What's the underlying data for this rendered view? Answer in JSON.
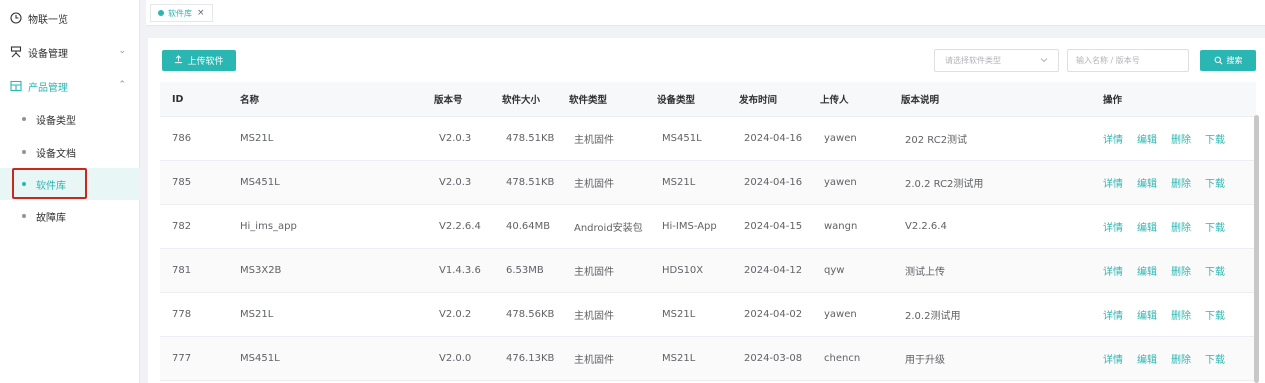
{
  "sidebar": {
    "items": [
      {
        "label": "物联一览",
        "icon": "clock-icon"
      },
      {
        "label": "设备管理",
        "icon": "device-icon",
        "chevron": "⌄"
      },
      {
        "label": "产品管理",
        "icon": "product-icon",
        "chevron": "⌃"
      }
    ],
    "sub_items": [
      {
        "label": "设备类型"
      },
      {
        "label": "设备文档"
      },
      {
        "label": "软件库"
      },
      {
        "label": "故障库"
      }
    ]
  },
  "tab": {
    "label": "软件库",
    "close": "×"
  },
  "toolbar": {
    "upload_label": "上传软件",
    "type_select_placeholder": "请选择软件类型",
    "search_placeholder": "输入名称 / 版本号",
    "search_label": "搜索"
  },
  "table": {
    "headers": [
      "ID",
      "名称",
      "版本号",
      "软件大小",
      "软件类型",
      "设备类型",
      "发布时间",
      "上传人",
      "版本说明",
      "操作"
    ],
    "actions": [
      "详情",
      "编辑",
      "删除",
      "下载"
    ],
    "rows": [
      {
        "id": "786",
        "name": "MS21L",
        "version": "V2.0.3",
        "size": "478.51KB",
        "type": "主机固件",
        "device": "MS451L",
        "date": "2024-04-16",
        "uploader": "yawen",
        "notes": "202 RC2测试"
      },
      {
        "id": "785",
        "name": "MS451L",
        "version": "V2.0.3",
        "size": "478.51KB",
        "type": "主机固件",
        "device": "MS21L",
        "date": "2024-04-16",
        "uploader": "yawen",
        "notes": "2.0.2 RC2测试用"
      },
      {
        "id": "782",
        "name": "Hi_ims_app",
        "version": "V2.2.6.4",
        "size": "40.64MB",
        "type": "Android安装包",
        "device": "Hi-IMS-App",
        "date": "2024-04-15",
        "uploader": "wangn",
        "notes": "V2.2.6.4"
      },
      {
        "id": "781",
        "name": "MS3X2B",
        "version": "V1.4.3.6",
        "size": "6.53MB",
        "type": "主机固件",
        "device": "HDS10X",
        "date": "2024-04-12",
        "uploader": "qyw",
        "notes": "测试上传"
      },
      {
        "id": "778",
        "name": "MS21L",
        "version": "V2.0.2",
        "size": "478.56KB",
        "type": "主机固件",
        "device": "MS21L",
        "date": "2024-04-02",
        "uploader": "yawen",
        "notes": "2.0.2测试用"
      },
      {
        "id": "777",
        "name": "MS451L",
        "version": "V2.0.0",
        "size": "476.13KB",
        "type": "主机固件",
        "device": "MS21L",
        "date": "2024-03-08",
        "uploader": "chencn",
        "notes": "用于升级"
      }
    ]
  },
  "colors": {
    "accent": "#2ab7b3",
    "highlight": "#c9271f"
  }
}
